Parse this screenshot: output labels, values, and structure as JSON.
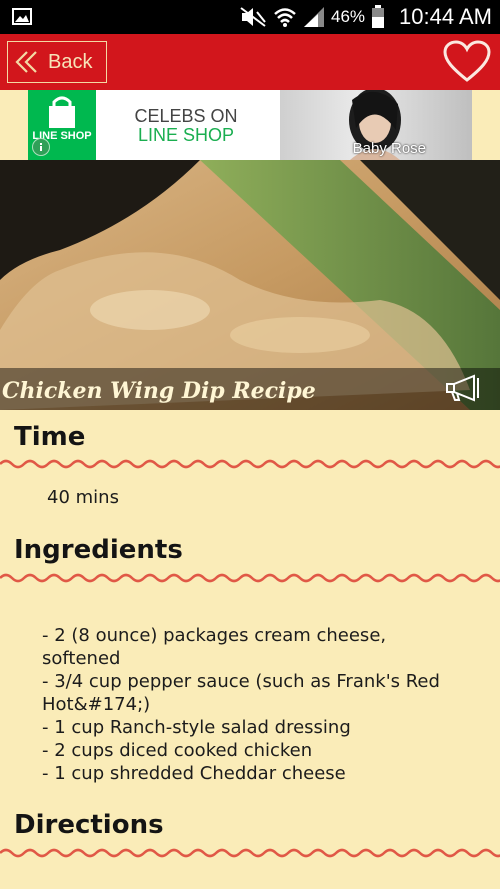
{
  "status_bar": {
    "battery_percent": "46%",
    "time": "10:44 AM",
    "icons": [
      "image-icon",
      "mute-icon",
      "wifi-icon",
      "signal-icon",
      "battery-icon"
    ]
  },
  "app_bar": {
    "back_label": "Back",
    "favorite_icon": "heart-icon",
    "accent_color": "#d2161c"
  },
  "ad_banner": {
    "logo_text": "LINE SHOP",
    "headline_1": "CELEBS ON",
    "headline_2": "LINE SHOP",
    "photo_caption": "Baby Rose"
  },
  "recipe": {
    "title": "Chicken Wing Dip Recipe",
    "time_heading": "Time",
    "time_value": "40 mins",
    "ingredients_heading": "Ingredients",
    "ingredients": [
      " -  2 (8 ounce) packages cream cheese,",
      "softened",
      " -  3/4 cup pepper sauce (such as Frank's Red",
      "Hot&#174;)",
      " -  1 cup Ranch-style salad dressing",
      " -  2 cups diced cooked chicken",
      " -  1 cup shredded Cheddar cheese"
    ],
    "directions_heading": "Directions"
  }
}
